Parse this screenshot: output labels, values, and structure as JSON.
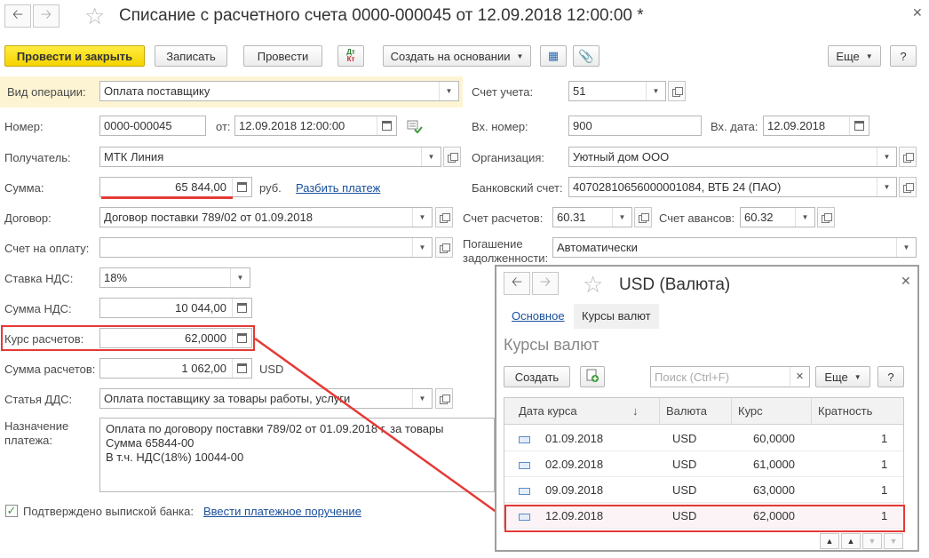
{
  "doc": {
    "title": "Списание с расчетного счета 0000-000045 от 12.09.2018 12:00:00 *",
    "toolbar": {
      "post_and_close": "Провести и закрыть",
      "save": "Записать",
      "post": "Провести",
      "dt_kt_top": "Дт",
      "dt_kt_bottom": "Кт",
      "create_based": "Создать на основании",
      "more": "Еще",
      "help": "?"
    },
    "operation_type": {
      "label": "Вид операции:",
      "value": "Оплата поставщику"
    },
    "account": {
      "label": "Счет учета:",
      "value": "51"
    },
    "number": {
      "label": "Номер:",
      "value": "0000-000045",
      "from_label": "от:",
      "date": "12.09.2018 12:00:00"
    },
    "incoming_number": {
      "label": "Вх. номер:",
      "value": "900",
      "date_label": "Вх. дата:",
      "date": "12.09.2018"
    },
    "recipient": {
      "label": "Получатель:",
      "value": "МТК Линия"
    },
    "organization": {
      "label": "Организация:",
      "value": "Уютный дом ООО"
    },
    "amount": {
      "label": "Сумма:",
      "value": "65 844,00",
      "currency": "руб.",
      "split_link": "Разбить платеж"
    },
    "bank_account": {
      "label": "Банковский счет:",
      "value": "40702810656000001084, ВТБ 24 (ПАО)"
    },
    "contract": {
      "label": "Договор:",
      "value": "Договор поставки 789/02 от 01.09.2018"
    },
    "settlement_account": {
      "label": "Счет расчетов:",
      "value": "60.31"
    },
    "advance_account": {
      "label": "Счет авансов:",
      "value": "60.32"
    },
    "invoice": {
      "label": "Счет на оплату:",
      "value": ""
    },
    "debt_repayment": {
      "label_line1": "Погашение",
      "label_line2": "задолженности:",
      "value": "Автоматически"
    },
    "vat_rate": {
      "label": "Ставка НДС:",
      "value": "18%"
    },
    "vat_amount": {
      "label": "Сумма НДС:",
      "value": "10 044,00"
    },
    "exchange_rate": {
      "label": "Курс расчетов:",
      "value": "62,0000"
    },
    "settlement_amount": {
      "label": "Сумма расчетов:",
      "value": "1 062,00",
      "currency": "USD"
    },
    "cash_flow_item": {
      "label": "Статья ДДС:",
      "value": "Оплата поставщику за товары работы, услуги"
    },
    "purpose": {
      "label_line1": "Назначение",
      "label_line2": "платежа:",
      "lines": [
        "Оплата по договору поставки 789/02 от 01.09.2018 г. за товары",
        "Сумма 65844-00",
        "В т.ч. НДС(18%) 10044-00"
      ]
    },
    "bank_confirmed": {
      "label": "Подтверждено выпиской банка:",
      "checked": true,
      "link": "Ввести платежное поручение"
    }
  },
  "currency_window": {
    "title": "USD (Валюта)",
    "tabs": [
      "Основное",
      "Курсы валют"
    ],
    "section_title": "Курсы валют",
    "create_button": "Создать",
    "search_placeholder": "Поиск (Ctrl+F)",
    "more": "Еще",
    "help": "?",
    "columns": [
      "Дата курса",
      "Валюта",
      "Курс",
      "Кратность"
    ],
    "rows": [
      {
        "date": "01.09.2018",
        "currency": "USD",
        "rate": "60,0000",
        "multiplier": "1"
      },
      {
        "date": "02.09.2018",
        "currency": "USD",
        "rate": "61,0000",
        "multiplier": "1"
      },
      {
        "date": "09.09.2018",
        "currency": "USD",
        "rate": "63,0000",
        "multiplier": "1"
      },
      {
        "date": "12.09.2018",
        "currency": "USD",
        "rate": "62,0000",
        "multiplier": "1"
      }
    ]
  },
  "colors": {
    "accent_yellow": "#f5d300",
    "highlight_red": "#e53935",
    "link_blue": "#1a4f9c",
    "operation_bg": "#fdf4d4"
  }
}
